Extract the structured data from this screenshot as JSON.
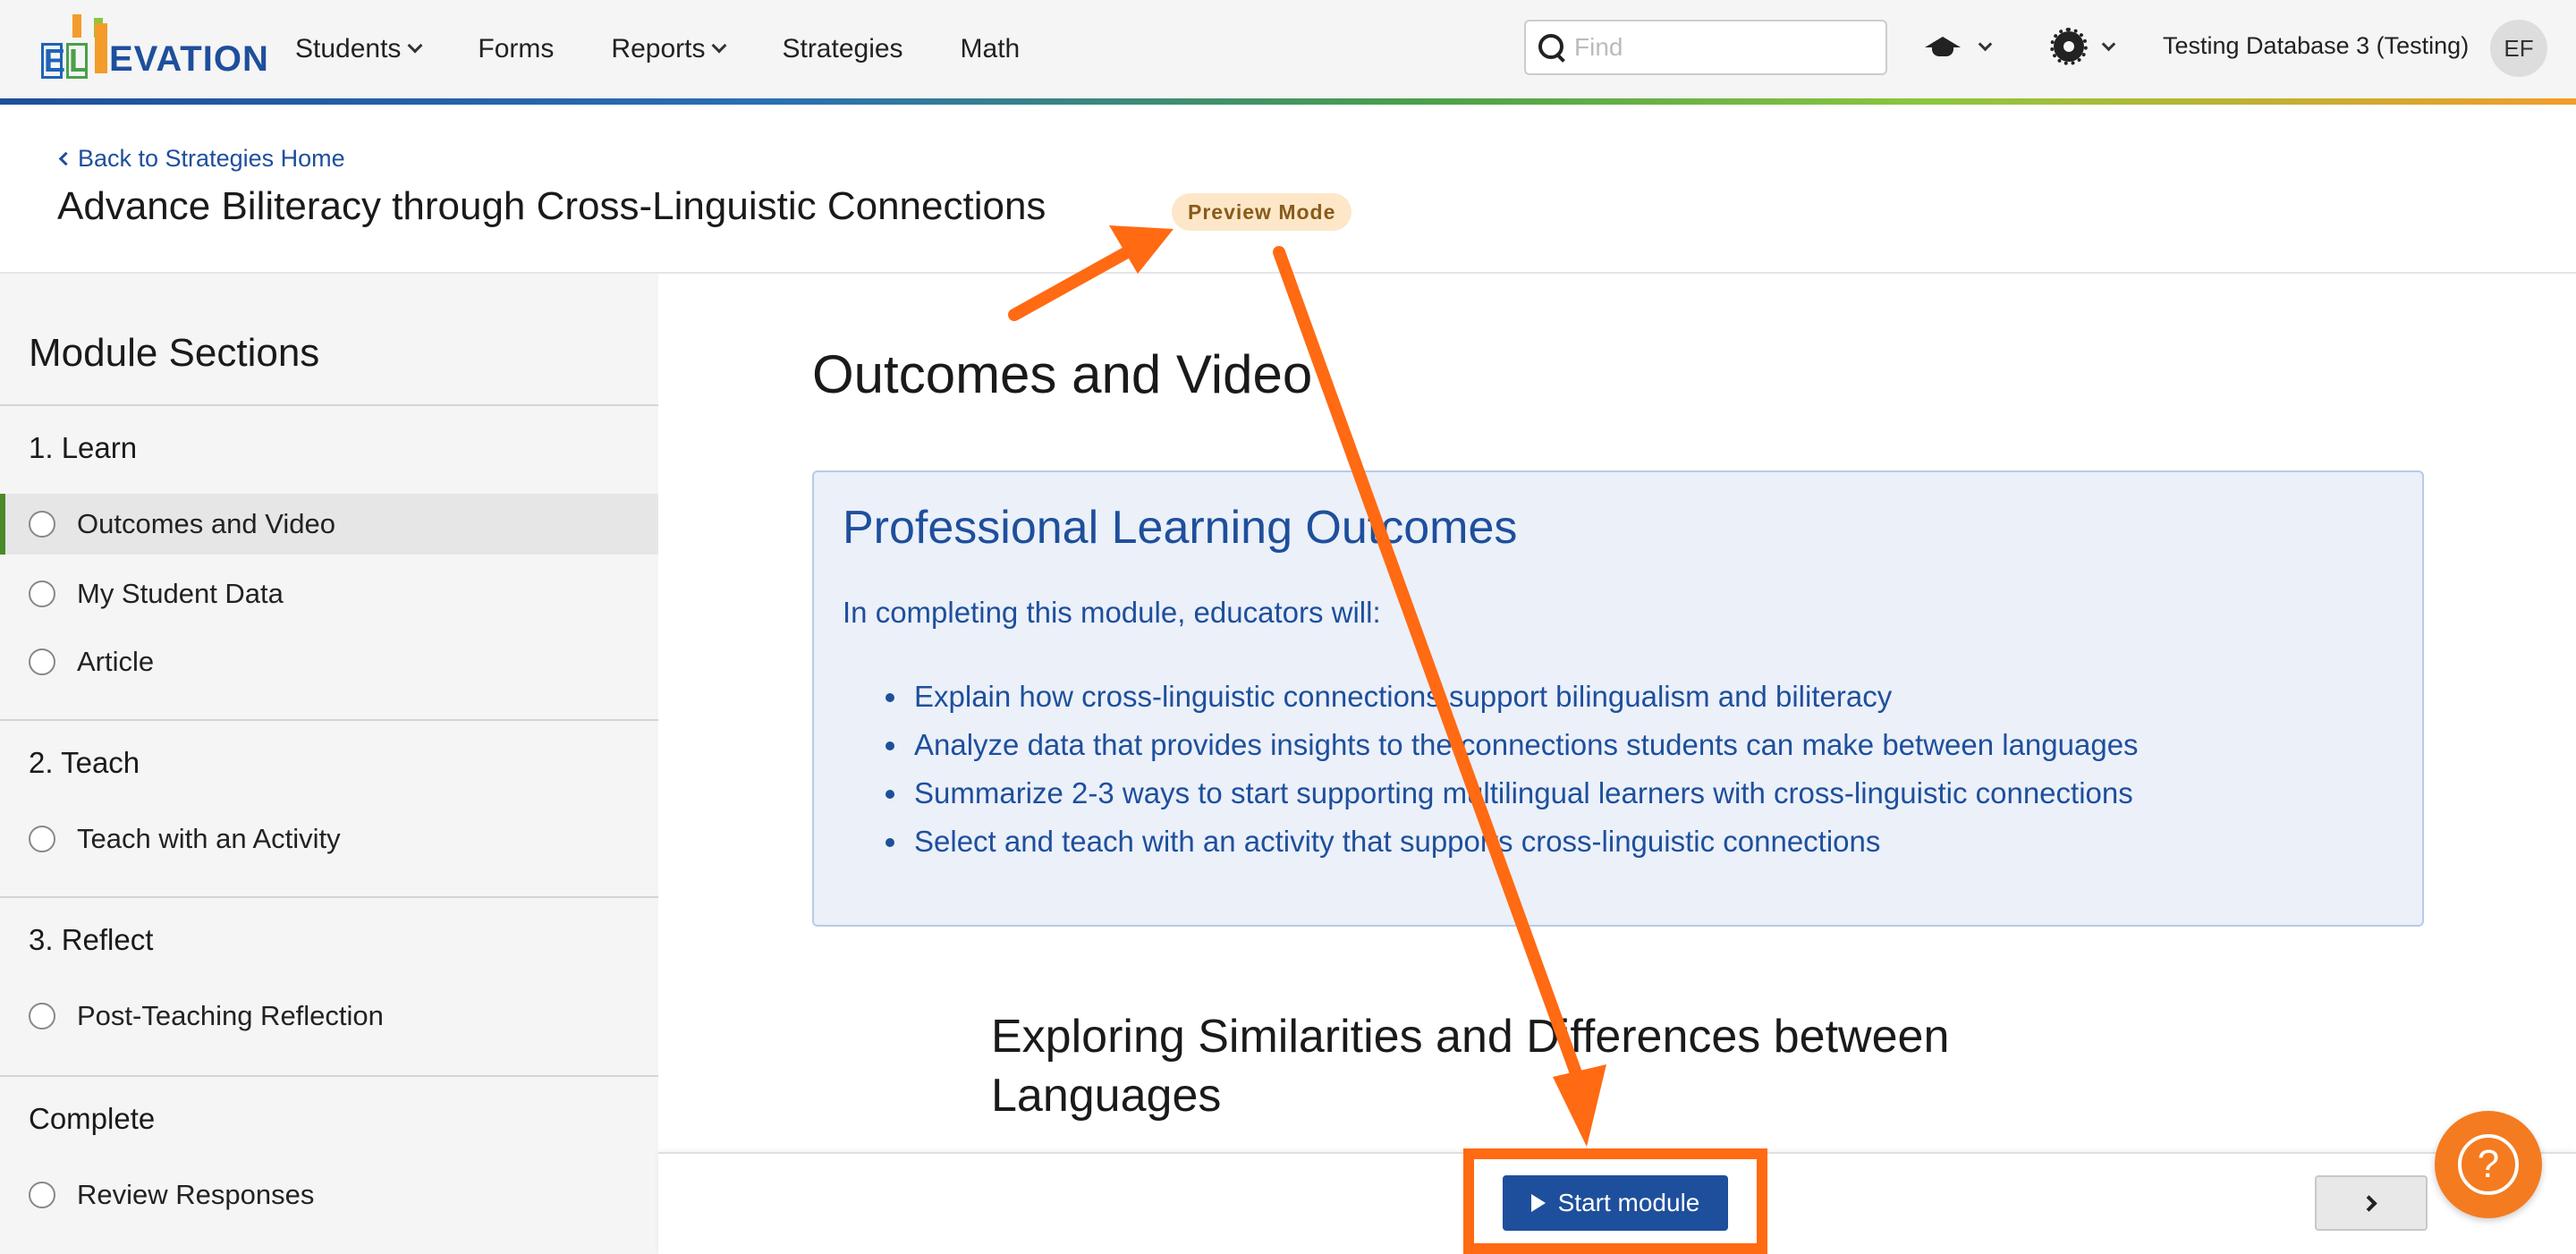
{
  "nav": {
    "logo_text": "ELLEVATION",
    "items": [
      {
        "label": "Students",
        "has_dropdown": true
      },
      {
        "label": "Forms",
        "has_dropdown": false
      },
      {
        "label": "Reports",
        "has_dropdown": true
      },
      {
        "label": "Strategies",
        "has_dropdown": false
      },
      {
        "label": "Math",
        "has_dropdown": false
      }
    ],
    "search_placeholder": "Find",
    "database_label": "Testing Database 3 (Testing)",
    "avatar_initials": "EF"
  },
  "header": {
    "back_link": "Back to Strategies Home",
    "title": "Advance Biliteracy through Cross-Linguistic Connections",
    "badge": "Preview Mode"
  },
  "sidebar": {
    "title": "Module Sections",
    "groups": [
      {
        "label": "1. Learn",
        "items": [
          {
            "label": "Outcomes and Video",
            "active": true
          },
          {
            "label": "My Student Data",
            "active": false
          },
          {
            "label": "Article",
            "active": false
          }
        ]
      },
      {
        "label": "2. Teach",
        "items": [
          {
            "label": "Teach with an Activity",
            "active": false
          }
        ]
      },
      {
        "label": "3. Reflect",
        "items": [
          {
            "label": "Post-Teaching Reflection",
            "active": false
          }
        ]
      },
      {
        "label": "Complete",
        "items": [
          {
            "label": "Review Responses",
            "active": false
          }
        ]
      }
    ]
  },
  "main": {
    "title": "Outcomes and Video",
    "outcomes": {
      "title": "Professional Learning Outcomes",
      "intro": "In completing this module, educators will:",
      "items": [
        "Explain how cross-linguistic connections support bilingualism and biliteracy",
        "Analyze data that provides insights to the connections students can make between languages",
        "Summarize 2-3 ways to start supporting multilingual learners with cross-linguistic connections",
        "Select and teach with an activity that supports cross-linguistic connections"
      ]
    },
    "section_title": "Exploring Similarities and Differences between Languages"
  },
  "footer": {
    "start_label": "Start module",
    "help_symbol": "?"
  },
  "colors": {
    "accent_blue": "#1e4f9c",
    "annotation_orange": "#ff6a13",
    "help_orange": "#f47b20",
    "active_marker": "#4a8a2a"
  }
}
